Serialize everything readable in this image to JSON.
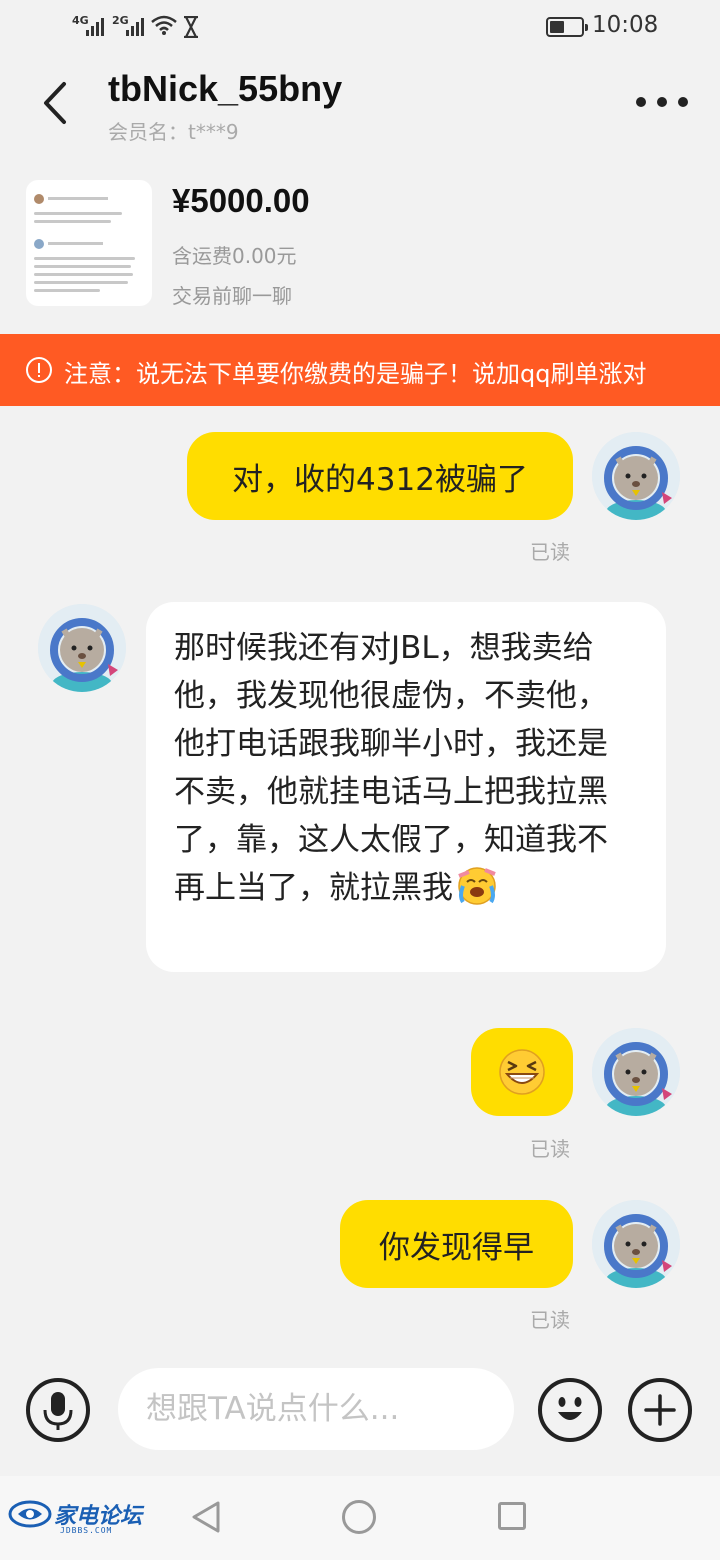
{
  "status_bar": {
    "signal1_label": "4G",
    "signal2_label": "2G",
    "battery_level": 0.45,
    "time": "10:08"
  },
  "header": {
    "title": "tbNick_55bny",
    "subtitle": "会员名：t***9"
  },
  "product": {
    "price": "¥5000.00",
    "shipping": "含运费0.00元",
    "note": "交易前聊一聊"
  },
  "warning": {
    "text": "注意：说无法下单要你缴费的是骗子！说加qq刷单涨对"
  },
  "messages": [
    {
      "side": "right",
      "text": "对，收的4312被骗了",
      "status": "已读"
    },
    {
      "side": "left",
      "text": "那时候我还有对JBL，想我卖给他，我发现他很虚伪，不卖他，他打电话跟我聊半小时，我还是不卖，他就挂电话马上把我拉黑了，靠，这人太假了，知道我不再上当了，就拉黑我",
      "emoji": "face-with-tears-icon"
    },
    {
      "side": "right",
      "emoji": "grinning-squinting-face-icon",
      "status": "已读"
    },
    {
      "side": "right",
      "text": "你发现得早",
      "status": "已读"
    }
  ],
  "input_bar": {
    "placeholder": "想跟TA说点什么..."
  },
  "watermark": {
    "text": "家电论坛",
    "sub": "JDBBS.COM"
  },
  "colors": {
    "accent_yellow": "#ffdd00",
    "warning_orange": "#ff5a23",
    "background": "#f2f2f2"
  }
}
